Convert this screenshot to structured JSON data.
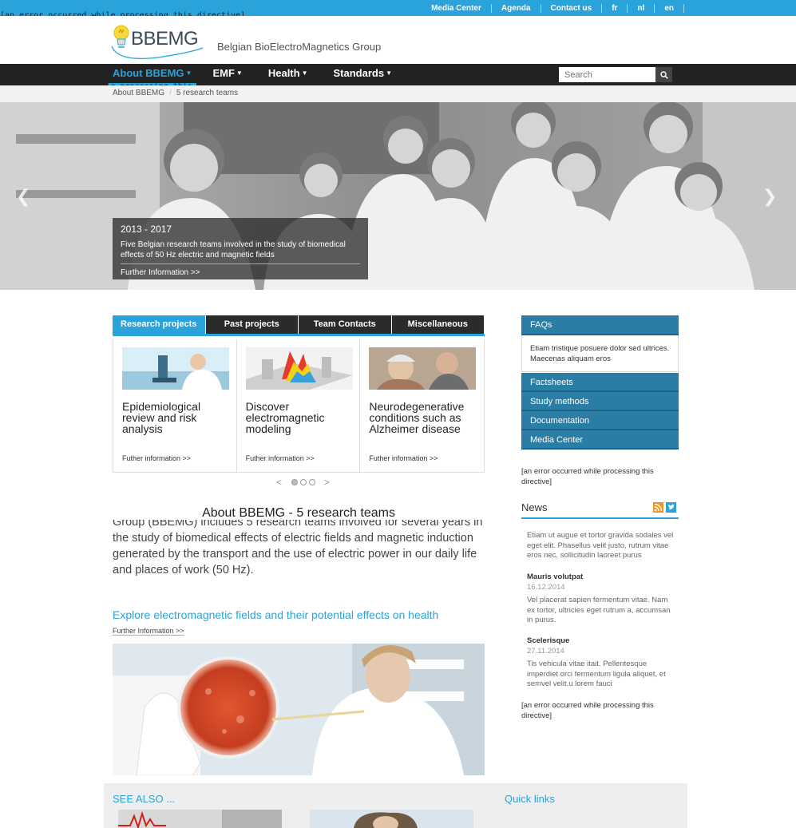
{
  "topbar": {
    "links": [
      "Media Center",
      "Agenda",
      "Contact us",
      "fr",
      "nl",
      "en"
    ],
    "error_text": "[an error occurred while processing this directive]"
  },
  "header": {
    "logo_text": "BBEMG",
    "tagline": "Belgian BioElectroMagnetics Group"
  },
  "nav": {
    "items": [
      "About BBEMG",
      "EMF",
      "Health",
      "Standards"
    ],
    "search_placeholder": "Search",
    "error_text": "[an error occurred while processing this directive]"
  },
  "breadcrumb": [
    "About BBEMG",
    "5 research teams"
  ],
  "hero": {
    "year": "2013 - 2017",
    "text": "Five Belgian research teams involved in the study of biomedical effects of 50 Hz electric and magnetic fields",
    "more": "Further Information >>"
  },
  "tabs": [
    "Research projects",
    "Past projects",
    "Team Contacts",
    "Miscellaneous"
  ],
  "cards": [
    {
      "title": "Epidemiological review and risk analysis",
      "more": "Futher information >>"
    },
    {
      "title": "Discover electromagnetic modeling",
      "more": "Futher information >>"
    },
    {
      "title": "Neurodegenerative conditions such as Alzheimer disease",
      "more": "Futher information >>"
    }
  ],
  "pager": {
    "prev": "<",
    "next": ">"
  },
  "main": {
    "title": "About BBEMG - 5 research teams",
    "body": "Group (BBEMG) includes 5 research teams involved for several years in the study of biomedical effects of electric fields and magnetic induction generated by the transport and the use of electric power in our daily life and places of work (50 Hz).",
    "explore": "Explore electromagnetic fields and their potential effects on health",
    "explore_more": "Further Information >>"
  },
  "sidebar": {
    "faq": "FAQs",
    "faq_body": "Etiam tristique posuere dolor sed ultrices. Maecenas aliquam eros",
    "links": [
      "Factsheets",
      "Study methods",
      "Documentation",
      "Media Center"
    ],
    "error_text": "[an error occurred while processing this directive]",
    "news_title": "News",
    "news": [
      {
        "title": "",
        "date": "",
        "text": "Etiam ut augue et tortor gravida sodales vel eget elit. Phasellus velit justo, rutrum vitae eros nec, sollicitudin laoreet purus"
      },
      {
        "title": "Mauris volutpat",
        "date": "16.12.2014",
        "text": "Vel placerat sapien fermentum vitae. Nam ex tortor, ultricies eget rutrum a, accumsan in purus."
      },
      {
        "title": "Scelerisque",
        "date": "27.11.2014",
        "text": "Tis vehicula vitae itait. Pellentesque imperdiet orci fermentum ligula aliquet, et semvel velit.u lorem fauci"
      }
    ],
    "error_text2": "[an error occurred while processing this directive]"
  },
  "footer": {
    "see_also": "SEE ALSO ...",
    "quick_links": "Quick links"
  },
  "colors": {
    "accent": "#2aa3da",
    "sidebar_blue": "#2a7ea5",
    "nav_dark": "#222222"
  }
}
